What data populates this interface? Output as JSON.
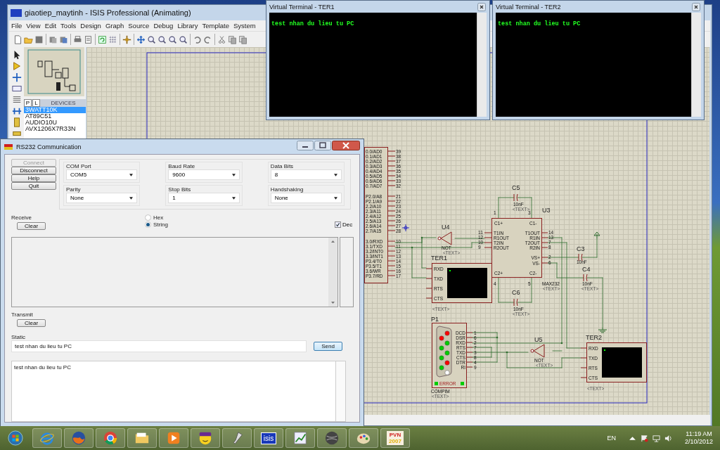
{
  "isis": {
    "title": "giaotiep_maytinh - ISIS Professional (Animating)",
    "menu": [
      "File",
      "View",
      "Edit",
      "Tools",
      "Design",
      "Graph",
      "Source",
      "Debug",
      "Library",
      "Template",
      "System"
    ],
    "picker_tabs": [
      "P",
      "L"
    ],
    "picker_title": "DEVICES",
    "devices": [
      {
        "name": "3WATT10K",
        "selected": true
      },
      {
        "name": "AT89C51",
        "selected": false
      },
      {
        "name": "AUDIO10U",
        "selected": false
      },
      {
        "name": "AVX1206X7R33N",
        "selected": false
      }
    ]
  },
  "schematic": {
    "mcu_pins": [
      {
        "label": "0.0/AD0",
        "number": "39"
      },
      {
        "label": "0.1/AD1",
        "number": "38"
      },
      {
        "label": "0.2/AD2",
        "number": "37"
      },
      {
        "label": "0.3/AD3",
        "number": "36"
      },
      {
        "label": "0.4/AD4",
        "number": "35"
      },
      {
        "label": "0.5/AD5",
        "number": "34"
      },
      {
        "label": "0.6/AD6",
        "number": "33"
      },
      {
        "label": "0.7/AD7",
        "number": "32"
      },
      {
        "label": "P2.0/A8",
        "number": "21"
      },
      {
        "label": "P2.1/A9",
        "number": "22"
      },
      {
        "label": "2.2/A10",
        "number": "23"
      },
      {
        "label": "2.3/A11",
        "number": "24"
      },
      {
        "label": "2.4/A12",
        "number": "25"
      },
      {
        "label": "2.5/A13",
        "number": "26"
      },
      {
        "label": "2.6/A14",
        "number": "27"
      },
      {
        "label": "2.7/A15",
        "number": "28"
      },
      {
        "label": "3.0/RXD",
        "number": "10"
      },
      {
        "label": "3.1/TXD",
        "number": "11"
      },
      {
        "label": "3.2/INT0",
        "number": "12"
      },
      {
        "label": "3.3/INT1",
        "number": "13"
      },
      {
        "label": "P3.4/T0",
        "number": "14"
      },
      {
        "label": "P3.5/T1",
        "number": "15"
      },
      {
        "label": "3.6/WR",
        "number": "16"
      },
      {
        "label": "P3.7/RD",
        "number": "17"
      }
    ],
    "max232": {
      "ref": "U3",
      "part": "MAX232",
      "tag": "<TEXT>",
      "top_pins": [
        {
          "name": "C1+",
          "number": "1"
        },
        {
          "name": "C1-",
          "number": "3"
        }
      ],
      "bottom_pins": [
        {
          "name": "C2+",
          "number": "4"
        },
        {
          "name": "C2-",
          "number": "5"
        }
      ],
      "left_pins": [
        {
          "name": "T1IN",
          "number": "11"
        },
        {
          "name": "R1OUT",
          "number": "12"
        },
        {
          "name": "T2IN",
          "number": "10"
        },
        {
          "name": "R2OUT",
          "number": "9"
        }
      ],
      "right_pins": [
        {
          "name": "T1OUT",
          "number": "14"
        },
        {
          "name": "R1IN",
          "number": "13"
        },
        {
          "name": "T2OUT",
          "number": "7"
        },
        {
          "name": "R2IN",
          "number": "8"
        },
        {
          "name": "VS+",
          "number": "2"
        },
        {
          "name": "VS-",
          "number": "6"
        }
      ]
    },
    "capacitors": [
      {
        "ref": "C5",
        "value": "10nF",
        "tag": "<TEXT>"
      },
      {
        "ref": "C6",
        "value": "10nF",
        "tag": "<TEXT>"
      },
      {
        "ref": "C3",
        "value": "10nF"
      },
      {
        "ref": "C4",
        "value": "10nF",
        "tag": "<TEXT>"
      }
    ],
    "gates": [
      {
        "ref": "U4",
        "type": "NOT",
        "tag": "<TEXT>"
      },
      {
        "ref": "U5",
        "type": "NOT",
        "tag": "<TEXT>"
      }
    ],
    "terminals": [
      {
        "ref": "TER1",
        "pins": [
          "RXD",
          "TXD",
          "RTS",
          "CTS"
        ],
        "tag": "<TEXT>"
      },
      {
        "ref": "TER2",
        "pins": [
          "RXD",
          "TXD",
          "RTS",
          "CTS"
        ],
        "tag": "<TEXT>"
      }
    ],
    "connector": {
      "ref": "P1",
      "part": "COMPIM",
      "tag": "<TEXT>",
      "status": "ERROR",
      "pins": [
        {
          "name": "DCD",
          "number": "1"
        },
        {
          "name": "DSR",
          "number": "6"
        },
        {
          "name": "RXD",
          "number": "2"
        },
        {
          "name": "RTS",
          "number": "7"
        },
        {
          "name": "TXD",
          "number": "3"
        },
        {
          "name": "CTS",
          "number": "8"
        },
        {
          "name": "DTR",
          "number": "4"
        },
        {
          "name": "RI",
          "number": "9"
        }
      ],
      "leds": [
        {
          "color": "#ff0000"
        },
        {
          "color": "#00cc00"
        },
        {
          "color": "#00cc00"
        },
        {
          "color": "#ff0000"
        },
        {
          "color": "#ffffff"
        },
        {
          "color": "#ff0000"
        },
        {
          "color": "#00cc00"
        },
        {
          "color": "#00cc00"
        },
        {
          "color": "#00cc00"
        }
      ]
    }
  },
  "terminal_windows": [
    {
      "title": "Virtual Terminal - TER1",
      "text": "test nhan du lieu tu PC"
    },
    {
      "title": "Virtual Terminal - TER2",
      "text": "test nhan du lieu tu PC"
    }
  ],
  "rs232": {
    "title": "RS232 Communication",
    "buttons": [
      {
        "label": "Connect",
        "disabled": true
      },
      {
        "label": "Disconnect",
        "disabled": false
      },
      {
        "label": "Help",
        "disabled": false
      },
      {
        "label": "Quit",
        "disabled": false
      }
    ],
    "settings": [
      {
        "label": "COM Port",
        "value": "COM5"
      },
      {
        "label": "Baud Rate",
        "value": "9600"
      },
      {
        "label": "Data Bits",
        "value": "8"
      },
      {
        "label": "Parity",
        "value": "None"
      },
      {
        "label": "Stop Bits",
        "value": "1"
      },
      {
        "label": "Handshaking",
        "value": "None"
      }
    ],
    "receive": {
      "label": "Receive",
      "clear": "Clear",
      "formats": [
        {
          "label": "Hex",
          "selected": false
        },
        {
          "label": "String",
          "selected": true
        }
      ],
      "dec": {
        "label": "Dec",
        "checked": true
      }
    },
    "transmit": {
      "label": "Transmit",
      "clear": "Clear"
    },
    "static": {
      "label": "Static",
      "value": "test nhan du lieu tu PC",
      "send": "Send"
    },
    "log": "test nhan du lieu tu PC"
  },
  "taskbar": {
    "apps": [
      {
        "kind": "start"
      },
      {
        "kind": "ie"
      },
      {
        "kind": "firefox"
      },
      {
        "kind": "chrome"
      },
      {
        "kind": "folder"
      },
      {
        "kind": "media"
      },
      {
        "kind": "yahoo"
      },
      {
        "kind": "probe"
      },
      {
        "kind": "isis",
        "label": "isis"
      },
      {
        "kind": "chart"
      },
      {
        "kind": "sphere"
      },
      {
        "kind": "paint"
      },
      {
        "kind": "pvn",
        "label": "PVN",
        "sublabel": "2007"
      }
    ],
    "language": "EN",
    "time": "11:19 AM",
    "date": "2/10/2012"
  }
}
